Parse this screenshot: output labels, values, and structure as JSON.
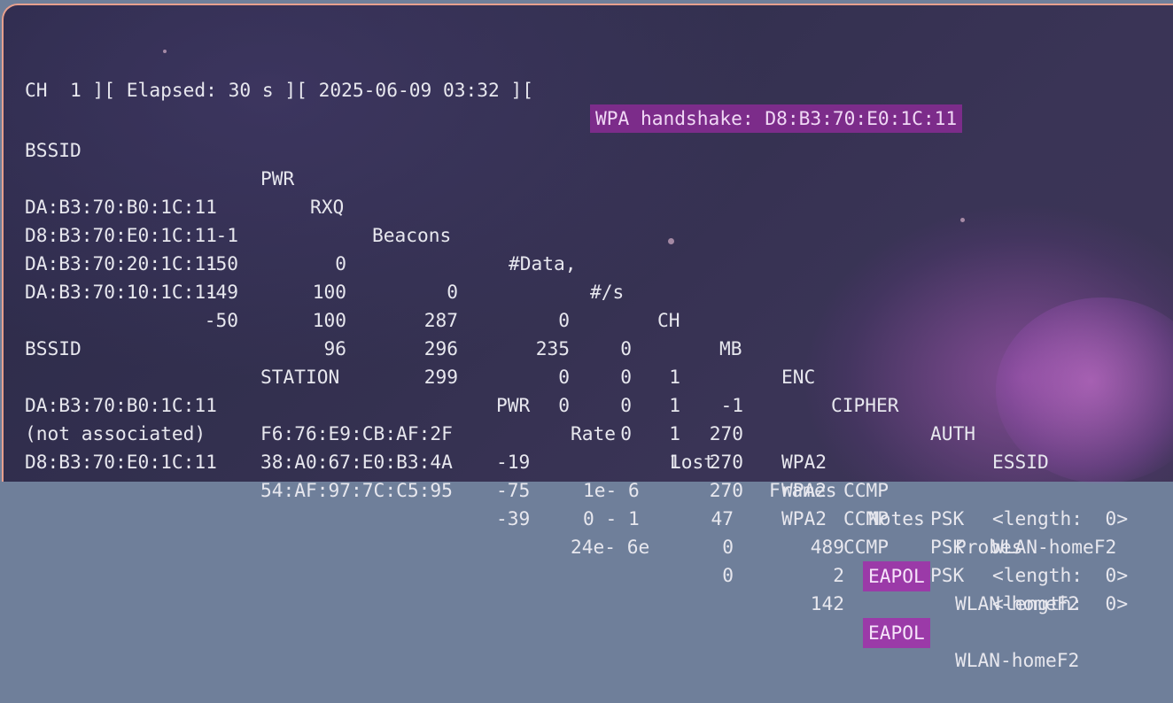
{
  "status": {
    "ch_segment": "CH  1 ][ Elapsed: 30 s ][ 2025-06-09 03:32 ][",
    "handshake": "WPA handshake: D8:B3:70:E0:1C:11"
  },
  "ap_table": {
    "headers": [
      "BSSID",
      "PWR",
      "RXQ",
      "Beacons",
      "#Data,",
      "#/s",
      "CH",
      "MB",
      "ENC",
      "CIPHER",
      "AUTH",
      "ESSID"
    ],
    "rows": [
      [
        "DA:B3:70:B0:1C:11",
        "-1",
        "0",
        "0",
        "0",
        "0",
        "1",
        "-1",
        "",
        "",
        "",
        "<length:  0>"
      ],
      [
        "D8:B3:70:E0:1C:11",
        "-50",
        "100",
        "287",
        "235",
        "0",
        "1",
        "270",
        "WPA2",
        "CCMP",
        "PSK",
        "WLAN-homeF2"
      ],
      [
        "DA:B3:70:20:1C:11",
        "-49",
        "100",
        "296",
        "0",
        "0",
        "1",
        "270",
        "WPA2",
        "CCMP",
        "PSK",
        "<length:  0>"
      ],
      [
        "DA:B3:70:10:1C:11",
        "-50",
        "96",
        "299",
        "0",
        "0",
        "1",
        "270",
        "WPA2",
        "CCMP",
        "PSK",
        "<length:  0>"
      ]
    ]
  },
  "station_table": {
    "headers": [
      "BSSID",
      "STATION",
      "PWR",
      "Rate",
      "Lost",
      "Frames",
      "Notes",
      "Probes"
    ],
    "rows": [
      [
        "DA:B3:70:B0:1C:11",
        "F6:76:E9:CB:AF:2F",
        "-19",
        "1e- 6",
        "47",
        "489",
        "EAPOL",
        "WLAN-homeF2"
      ],
      [
        "(not associated)",
        "38:A0:67:E0:B3:4A",
        "-75",
        "0 - 1",
        "0",
        "2",
        "",
        ""
      ],
      [
        "D8:B3:70:E0:1C:11",
        "54:AF:97:7C:C5:95",
        "-39",
        "24e- 6e",
        "0",
        "142",
        "EAPOL",
        "WLAN-homeF2"
      ]
    ]
  },
  "colors": {
    "background": "#2c2a49",
    "text": "#e7e7ee",
    "highlight": "#7c2c8a",
    "notes_highlight": "#9b3aa8",
    "window_border": "#e7a08e"
  }
}
